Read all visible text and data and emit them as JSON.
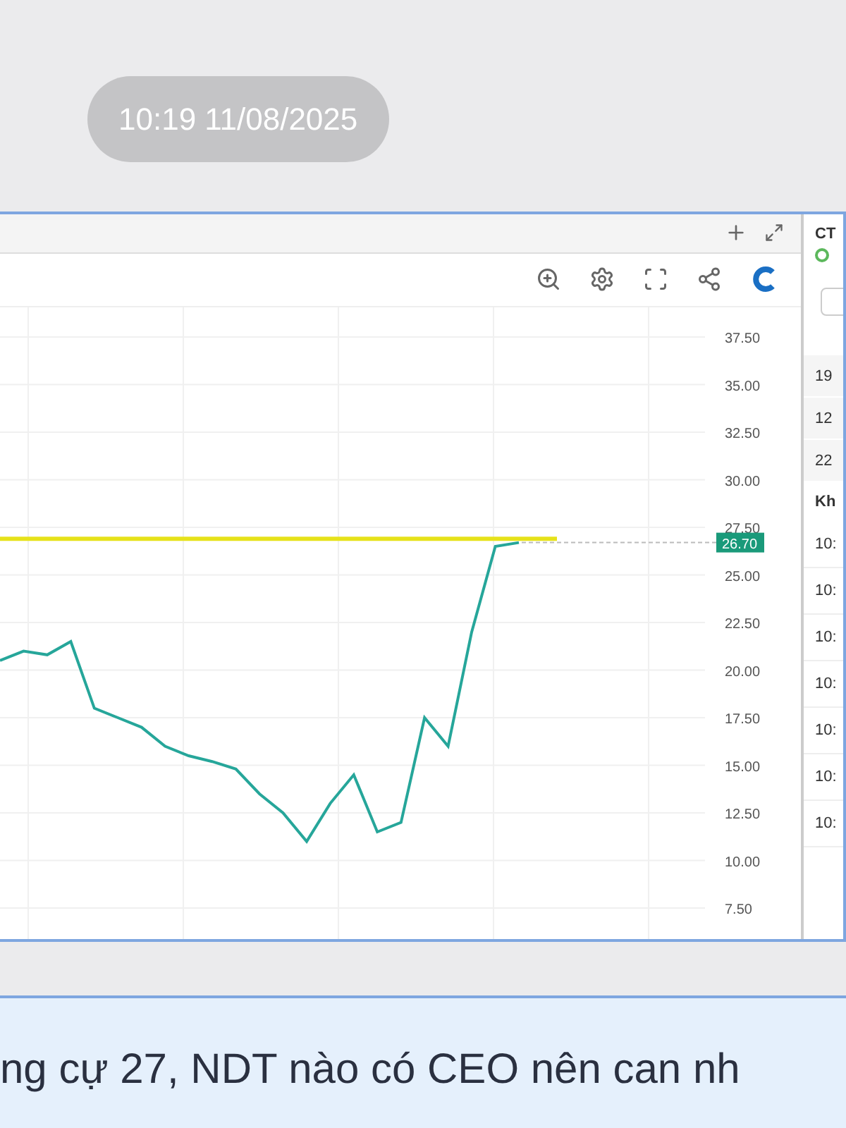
{
  "timestamp": "10:19 11/08/2025",
  "chart_window": {
    "chart_data": {
      "type": "line",
      "grid": true,
      "series": [
        {
          "color": "#26a69a",
          "values": [
            20.5,
            21,
            20.8,
            21.5,
            18,
            17.5,
            17,
            16,
            15.5,
            15.2,
            14.8,
            13.5,
            12.5,
            11,
            13,
            14.5,
            11.5,
            12,
            17.5,
            16,
            22,
            26.5,
            26.7
          ]
        }
      ],
      "yticks": [
        {
          "value": 37.5,
          "label": "37.50"
        },
        {
          "value": 35,
          "label": "35.00"
        },
        {
          "value": 32.5,
          "label": "32.50"
        },
        {
          "value": 30,
          "label": "30.00"
        },
        {
          "value": 27.5,
          "label": "27.50"
        },
        {
          "value": 25,
          "label": "25.00"
        },
        {
          "value": 22.5,
          "label": "22.50"
        },
        {
          "value": 20,
          "label": "20.00"
        },
        {
          "value": 17.5,
          "label": "17.50"
        },
        {
          "value": 15,
          "label": "15.00"
        },
        {
          "value": 12.5,
          "label": "12.50"
        },
        {
          "value": 10,
          "label": "10.00"
        },
        {
          "value": 7.5,
          "label": "7.50"
        }
      ],
      "ref_lines": [
        {
          "axis": "y",
          "value": 26.9,
          "color": "#e6e21a"
        }
      ],
      "ylim": [
        7.5,
        37.5
      ],
      "annotations": [
        "26.70"
      ]
    },
    "side_panel": {
      "title": "CT",
      "prices": [
        "19",
        "12",
        "22"
      ],
      "section": "Kh",
      "times": [
        "10:",
        "10:",
        "10:",
        "10:",
        "10:",
        "10:",
        "10:"
      ]
    }
  },
  "message": "ng cự 27, NDT nào có CEO nên can nh"
}
